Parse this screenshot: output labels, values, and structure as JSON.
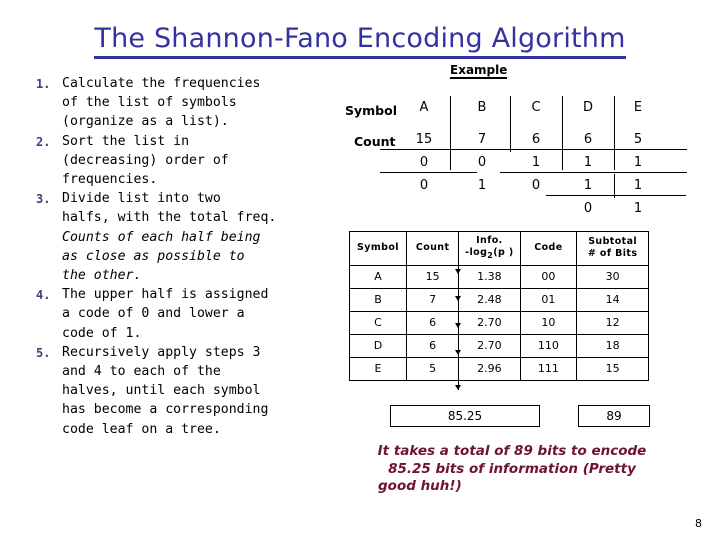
{
  "slide": {
    "title": "The Shannon-Fano Encoding Algorithm",
    "page_number": "8"
  },
  "steps": [
    {
      "num": "1.",
      "line1": "Calculate the frequencies",
      "line2": "of the list of symbols",
      "line3": "(organize as a list)."
    },
    {
      "num": "2.",
      "line1": "Sort the list in",
      "line2": "(decreasing) order of",
      "line3": "frequencies."
    },
    {
      "num": "3.",
      "line1": "Divide list into two",
      "line2": "halfs, with the total freq.",
      "italic1": "Counts of each half being",
      "italic2": "as close as possible to",
      "italic3": "the other."
    },
    {
      "num": "4.",
      "line1": "The upper half is assigned",
      "line2": "a code of 0 and lower a",
      "line3": "code of 1."
    },
    {
      "num": "5.",
      "line1": "Recursively apply steps 3",
      "line2": "and 4 to each of the",
      "line3": "halves, until each symbol",
      "line4": "has become a corresponding",
      "line5": "code leaf on a tree."
    }
  ],
  "example": {
    "heading": "Example",
    "row_labels": {
      "symbol": "Symbol",
      "count": "Count"
    },
    "symbols": [
      "A",
      "B",
      "C",
      "D",
      "E"
    ],
    "counts": [
      "15",
      "7",
      "6",
      "6",
      "5"
    ],
    "bits_level1": [
      "0",
      "0",
      "1",
      "1",
      "1"
    ],
    "bits_level2": [
      "0",
      "1",
      "0",
      "1",
      "1"
    ],
    "bits_level3": [
      "0",
      "1"
    ]
  },
  "table": {
    "headers": {
      "symbol": "Symbol",
      "count": "Count",
      "info_line1": "Info.",
      "info_line2_pre": "-log",
      "info_line2_sub": "2",
      "info_line2_post": "(p )",
      "code": "Code",
      "subtotal_line1": "Subtotal",
      "subtotal_line2": "# of Bits"
    },
    "rows": [
      {
        "symbol": "A",
        "count": "15",
        "info": "1.38",
        "code": "00",
        "subtotal": "30"
      },
      {
        "symbol": "B",
        "count": "7",
        "info": "2.48",
        "code": "01",
        "subtotal": "14"
      },
      {
        "symbol": "C",
        "count": "6",
        "info": "2.70",
        "code": "10",
        "subtotal": "12"
      },
      {
        "symbol": "D",
        "count": "6",
        "info": "2.70",
        "code": "110",
        "subtotal": "18"
      },
      {
        "symbol": "E",
        "count": "5",
        "info": "2.96",
        "code": "111",
        "subtotal": "15"
      }
    ]
  },
  "totals": {
    "information_bits": "85.25",
    "encoded_bits": "89"
  },
  "caption": {
    "line1": "It takes a total of 89 bits to encode",
    "line2": "85.25 bits of information (Pretty",
    "line3": "good huh!)"
  },
  "colors": {
    "title": "#3333A0",
    "step_number": "#3F3F7A",
    "caption": "#6E1430",
    "rule": "#000000"
  }
}
